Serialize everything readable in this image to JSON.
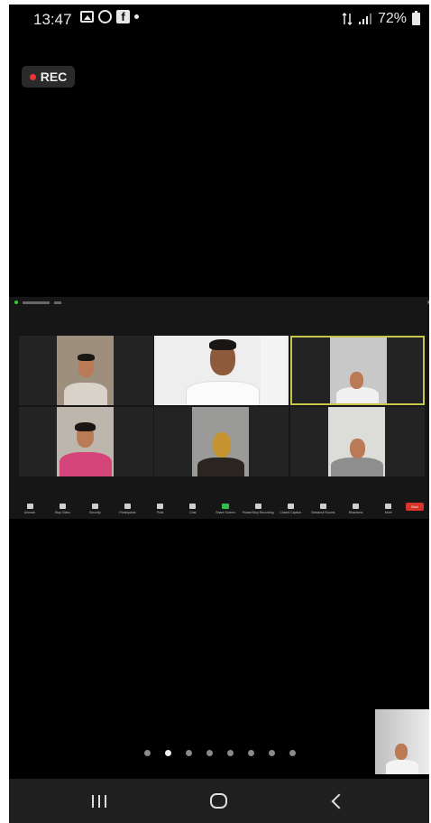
{
  "status_bar": {
    "time": "13:47",
    "battery": "72%",
    "icons": [
      "gallery-icon",
      "whatsapp-icon",
      "facebook-icon",
      "notification-dot-icon",
      "data-arrows-icon",
      "signal-icon",
      "battery-icon"
    ]
  },
  "recording": {
    "label": "REC",
    "color": "#e33333"
  },
  "meeting": {
    "active_border_color": "#c6c74a",
    "toolbar": {
      "items": [
        "Unmute",
        "Stop Video",
        "Security",
        "Participants",
        "Polls",
        "Chat",
        "Share Screen",
        "Pause/Stop Recording",
        "Closed Caption",
        "Breakout Rooms",
        "Reactions",
        "More"
      ],
      "end_label": "End",
      "participants_count": "17"
    }
  },
  "pager": {
    "count": 8,
    "active_index": 1
  },
  "colors": {
    "end": "#d9342b",
    "share": "#2fbf4a"
  }
}
